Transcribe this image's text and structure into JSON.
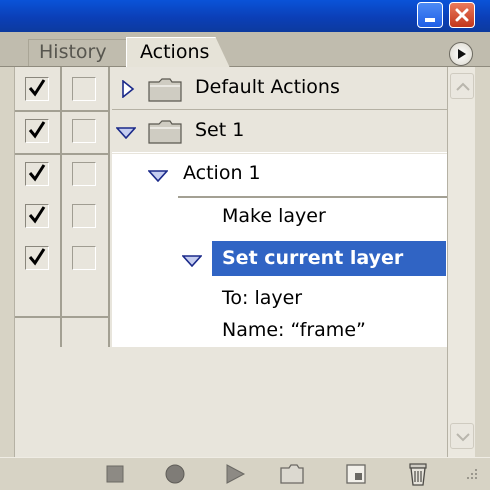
{
  "panel": {
    "tabs": [
      {
        "label": "History",
        "active": false
      },
      {
        "label": "Actions",
        "active": true
      }
    ]
  },
  "rows": [
    {
      "label": "Default Actions",
      "type": "set",
      "expanded": false,
      "checked": true
    },
    {
      "label": "Set 1",
      "type": "set",
      "expanded": true,
      "checked": true
    },
    {
      "label": "Action 1",
      "type": "action",
      "expanded": true,
      "checked": true
    },
    {
      "label": "Make layer",
      "type": "command",
      "checked": true
    },
    {
      "label": "Set current layer",
      "type": "command",
      "expanded": true,
      "selected": true,
      "checked": true
    },
    {
      "label": "To: layer",
      "type": "parameter"
    },
    {
      "label": "Name:  “frame”",
      "type": "parameter"
    }
  ],
  "toolbar": {
    "icons": [
      "stop-icon",
      "record-icon",
      "play-icon",
      "new-set-icon",
      "new-action-icon",
      "trash-icon"
    ]
  },
  "colors": {
    "selection": "#3064c4",
    "titlebar": "#0b3fb7",
    "panel_bg": "#e8e5dc"
  }
}
